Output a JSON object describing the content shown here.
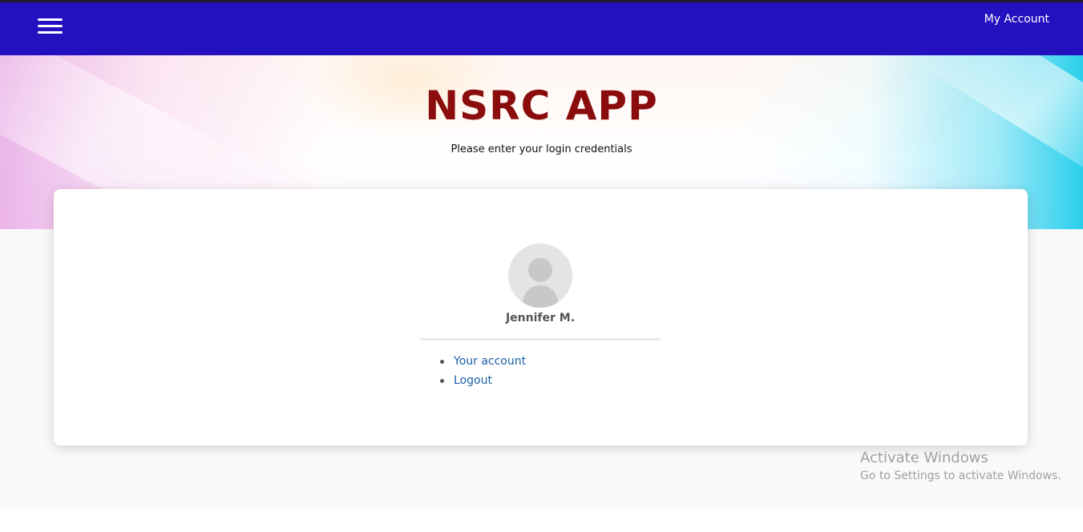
{
  "navbar": {
    "background_color": "#2310bf",
    "menu_icon": "hamburger-menu-icon",
    "account_link_label": "My Account"
  },
  "hero": {
    "title": "NSRC APP",
    "title_color": "#8a0c0c",
    "subtitle": "Please enter your login credentials"
  },
  "account_card": {
    "avatar_icon": "user-avatar-placeholder-icon",
    "user_name": "Jennifer M.",
    "links": [
      {
        "label": "Your account"
      },
      {
        "label": "Logout"
      }
    ],
    "link_color": "#1a5fa8"
  },
  "watermark": {
    "title": "Activate Windows",
    "subtitle": "Go to Settings to activate Windows."
  }
}
